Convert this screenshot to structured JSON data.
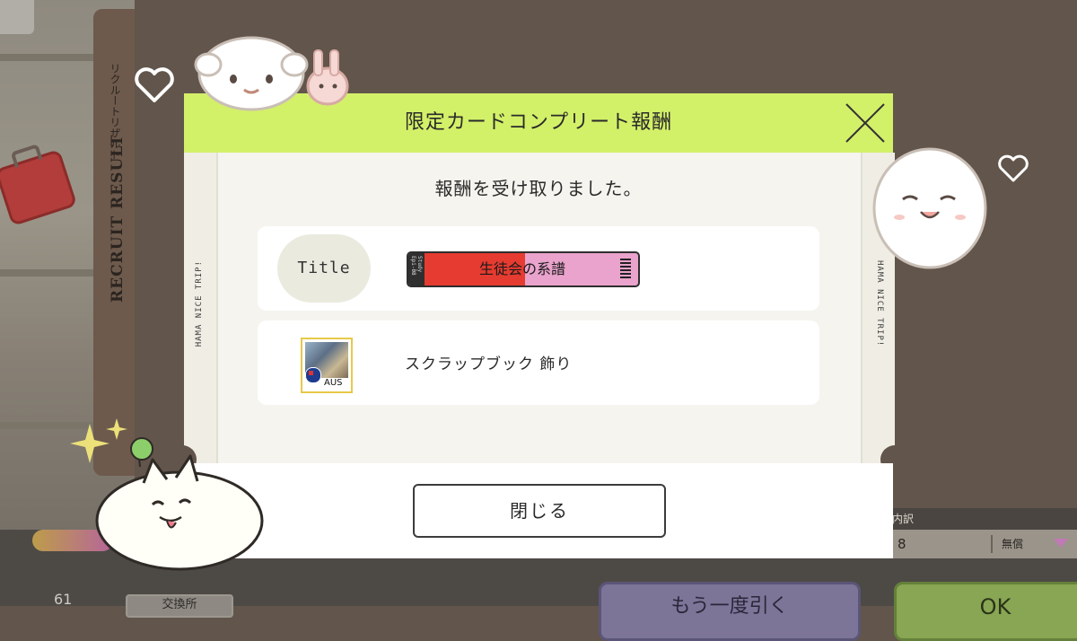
{
  "background": {
    "recruit_title_en": "RECRUIT RESULT",
    "recruit_title_jp": "リクルートリザルト",
    "left_count": "61",
    "exchange_label": "交換所",
    "again_button": "もう一度引く",
    "ok_button": "OK",
    "breakdown_label": "内訳",
    "breakdown_value": "8",
    "breakdown_free": "無償"
  },
  "modal": {
    "title": "限定カードコンプリート報酬",
    "subtitle": "報酬を受け取りました。",
    "strip_text": "HAMA NICE TRIP!",
    "close_button": "閉じる",
    "rewards": [
      {
        "type_label": "Title",
        "plate_text": "生徒会の系譜",
        "plate_side_text": "Study Epi-08",
        "icon": "title-plate"
      },
      {
        "name": "スクラップブック 飾り",
        "sticker_label": "AUS",
        "icon": "scrapbook-sticker"
      }
    ]
  },
  "colors": {
    "header": "#d3f069",
    "body": "#f5f4ef",
    "plate_red": "#e63b30",
    "plate_pink": "#e9a3cc",
    "backdrop": "#62554b"
  }
}
